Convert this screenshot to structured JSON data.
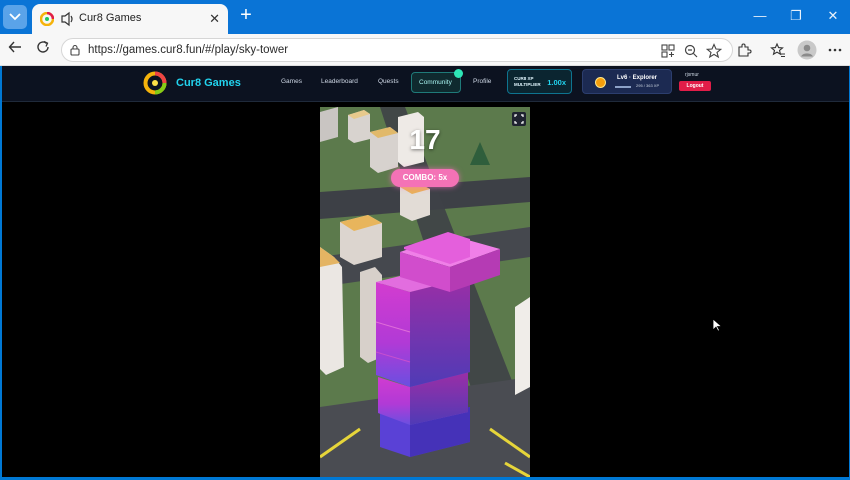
{
  "browser": {
    "tab_title": "Cur8 Games",
    "tab_close": "✕",
    "new_tab": "+",
    "url": "https://games.cur8.fun/#/play/sky-tower",
    "icons": [
      "tab-actions-icon",
      "speaker-icon",
      "back-icon",
      "refresh-icon",
      "lock-icon",
      "app-grid-icon",
      "zoom-icon",
      "favorite-star-icon",
      "extensions-icon",
      "favorites-icon",
      "profile-icon",
      "more-icon"
    ],
    "window_controls": {
      "minimize": "—",
      "restore": "❐",
      "close": "✕"
    }
  },
  "site": {
    "brand": "Cur8 Games",
    "nav": {
      "games": "Games",
      "leaderboard": "Leaderboard",
      "quests": "Quests",
      "community": "Community",
      "profile": "Profile"
    },
    "xp_multiplier": {
      "line1": "CUR8 XP",
      "line2": "MULTIPLIER",
      "value": "1.00x"
    },
    "user": {
      "level": "Lv6 · Explorer",
      "xp": "295 / 363 XP",
      "username": "rjsmur",
      "logout": "Logout"
    },
    "colors": {
      "accent": "#22d3ee",
      "logout": "#e11d48",
      "combo": "#f472b6"
    }
  },
  "game": {
    "title": "sky-tower",
    "score": "17",
    "combo": "COMBO: 5x"
  }
}
